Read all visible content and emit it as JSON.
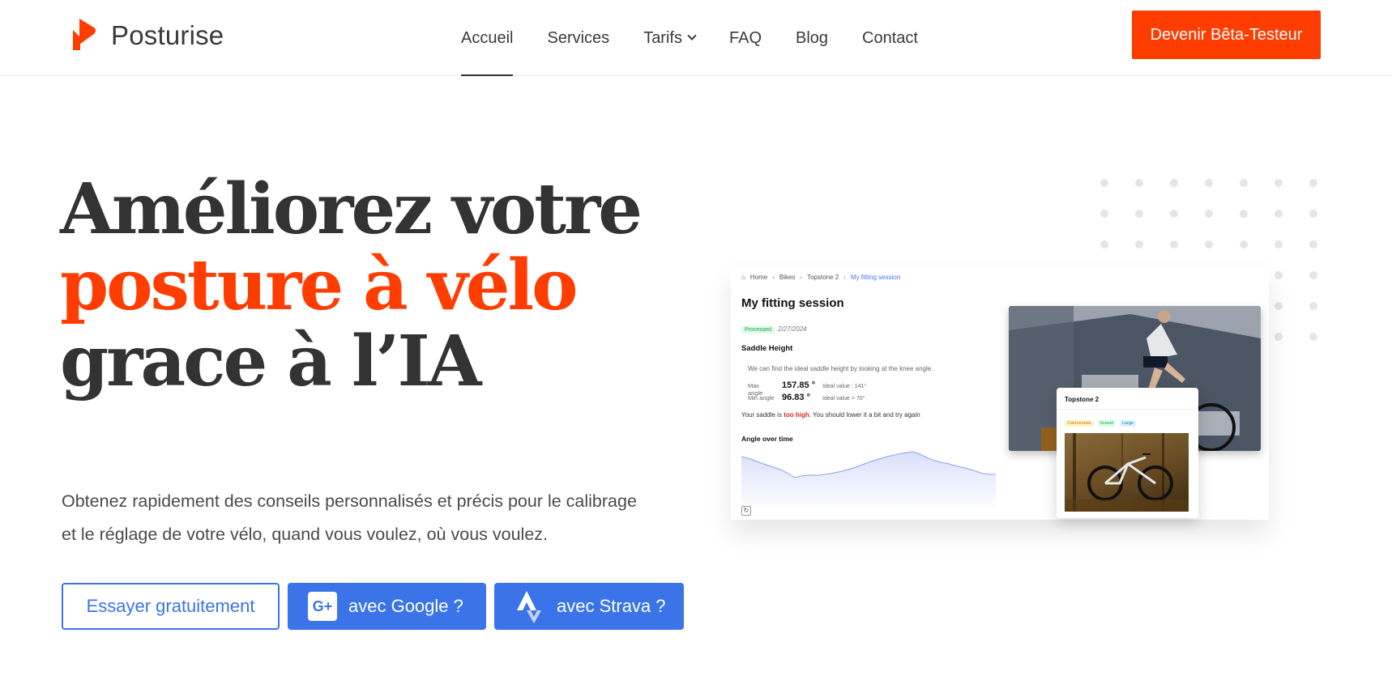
{
  "header": {
    "brand": "Posturise",
    "nav": [
      {
        "label": "Accueil",
        "active": true
      },
      {
        "label": "Services"
      },
      {
        "label": "Tarifs",
        "dropdown": true
      },
      {
        "label": "FAQ"
      },
      {
        "label": "Blog"
      },
      {
        "label": "Contact"
      }
    ],
    "cta_label": "Devenir Bêta-Testeur"
  },
  "hero": {
    "line1": "Améliorez votre",
    "line2": "posture à vélo",
    "line3": "grace à l’IA",
    "subtitle_line1": "Obtenez rapidement des conseils personnalisés et précis pour le calibrage",
    "subtitle_line2": "et le réglage de votre vélo, quand vous voulez, où vous voulez.",
    "btn_try": "Essayer gratuitement",
    "btn_google": "avec Google ?",
    "btn_strava": "avec Strava ?"
  },
  "mockup": {
    "breadcrumbs": [
      "Home",
      "Bikes",
      "Topstone 2",
      "My fitting session"
    ],
    "title": "My fitting session",
    "badge": "Processed",
    "date": "2/27/2024",
    "section": "Saddle Height",
    "description": "We can find the ideal saddle height by looking at the knee angle.",
    "max_label": "Max angle",
    "max_value": "157.85 °",
    "max_ideal": "Ideal value : 141°",
    "min_label": "Min angle",
    "min_value": "96.83 °",
    "min_ideal": "Ideal value > 70°",
    "warn_pre": "Your saddle is ",
    "warn_bold": "too high",
    "warn_post": ". You should lower it a bit and try again",
    "angle_title": "Angle over time",
    "card_title": "Topstone 2",
    "tags": [
      "Cannondale",
      "Gravel",
      "Large"
    ]
  },
  "colors": {
    "accent": "#ff3d00",
    "blue": "#3b74e8"
  }
}
